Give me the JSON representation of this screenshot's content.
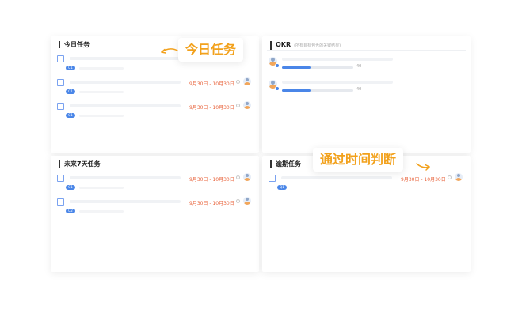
{
  "panels": {
    "today": {
      "title": "今日任务"
    },
    "okr": {
      "title": "OKR",
      "subtitle": "(所有目标包含的关键结果)"
    },
    "next7": {
      "title": "未来7天任务"
    },
    "overdue": {
      "title": "逾期任务"
    }
  },
  "tasks": {
    "today": [
      {
        "badge": "Q1",
        "date": ""
      },
      {
        "badge": "Q1",
        "date": "9月30日 - 10月30日"
      },
      {
        "badge": "Q1",
        "date": "9月30日 - 10月30日"
      }
    ],
    "next7": [
      {
        "badge": "Q1",
        "date": "9月30日 - 10月30日"
      },
      {
        "badge": "Q2",
        "date": "9月30日 - 10月30日"
      }
    ],
    "overdue": [
      {
        "badge": "Q1",
        "date": "9月30日 - 10月30日"
      }
    ]
  },
  "okr_rows": [
    {
      "progress": 0.4,
      "percent": "40"
    },
    {
      "progress": 0.4,
      "percent": "40"
    }
  ],
  "callouts": {
    "today": "今日任务",
    "time": "通过时间判断"
  },
  "colors": {
    "accent": "#4a86e8",
    "date": "#e8623a",
    "callout": "#f2a11c"
  }
}
